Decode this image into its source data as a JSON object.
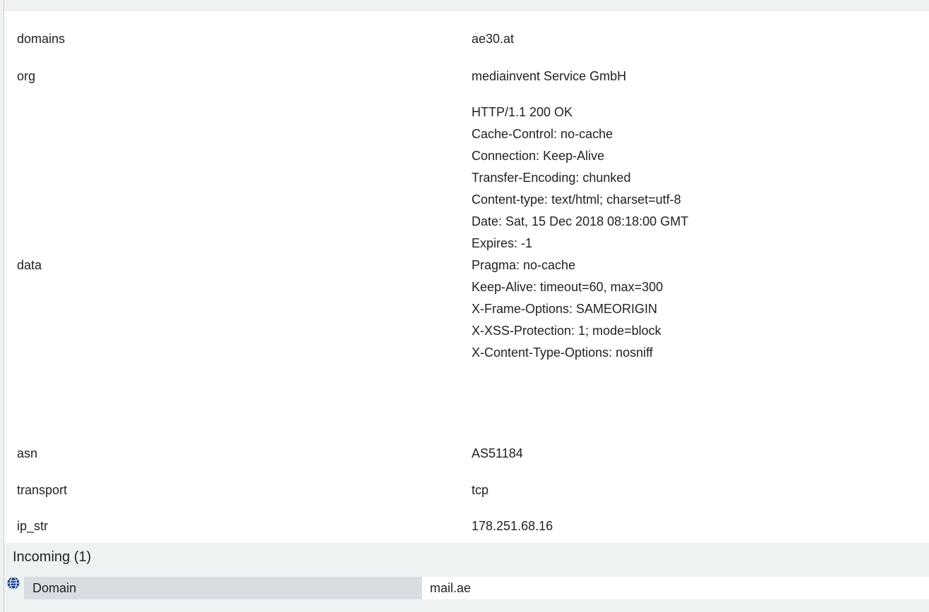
{
  "properties": [
    {
      "key": "domains",
      "value": "ae30.at"
    },
    {
      "key": "org",
      "value": "mediainvent Service GmbH"
    },
    {
      "key": "data",
      "lines": [
        "HTTP/1.1 200 OK",
        "Cache-Control: no-cache",
        "Connection: Keep-Alive",
        "Transfer-Encoding: chunked",
        "Content-type: text/html; charset=utf-8",
        "Date: Sat, 15 Dec 2018 08:18:00 GMT",
        "Expires: -1",
        "Pragma: no-cache",
        "Keep-Alive: timeout=60, max=300",
        "X-Frame-Options: SAMEORIGIN",
        "X-XSS-Protection: 1; mode=block",
        "X-Content-Type-Options: nosniff"
      ]
    },
    {
      "key": "asn",
      "value": "AS51184"
    },
    {
      "key": "transport",
      "value": "tcp"
    },
    {
      "key": "ip_str",
      "value": "178.251.68.16"
    }
  ],
  "incoming": {
    "title": "Incoming (1)",
    "rows": [
      {
        "label": "Domain",
        "value": "mail.ae",
        "icon": "globe-icon"
      }
    ]
  },
  "colors": {
    "page_background": "#eef2f3",
    "panel_background": "#ffffff",
    "label_cell_background": "#d7dde1",
    "globe_icon": "#1f3f8a"
  }
}
